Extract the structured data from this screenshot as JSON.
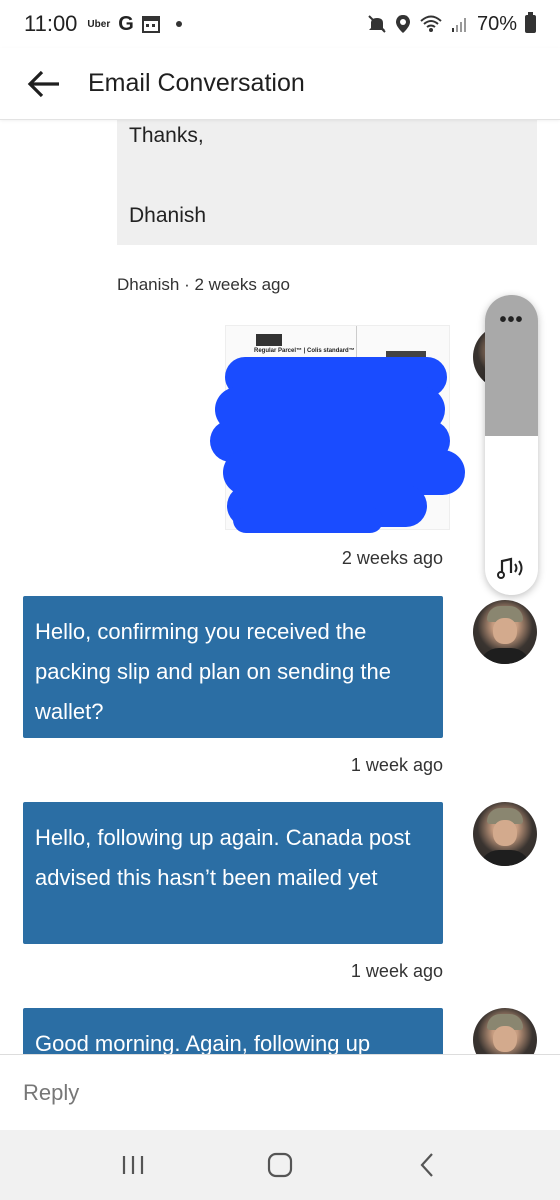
{
  "status_bar": {
    "time": "11:00",
    "uber_label": "Uber",
    "g_label": "G",
    "battery_pct": "70%",
    "icons": [
      "mute-icon",
      "location-icon",
      "wifi-icon",
      "signal-icon",
      "battery-icon"
    ]
  },
  "app_bar": {
    "title": "Email Conversation",
    "back_icon": "arrow-left-icon"
  },
  "conversation": {
    "previous_message": {
      "line1": "Thanks,",
      "line2": "Dhanish"
    },
    "attachment_meta": "Dhanish · 2 weeks ago",
    "attachment_doc_label": "Regular Parcel™ | Colis standard™",
    "attachment_time": "2 weeks ago",
    "messages": [
      {
        "text": "Hello, confirming you received the packing slip and plan on sending the wallet?",
        "time": "1 week ago"
      },
      {
        "text": "Hello, following up again. Canada post advised this hasn’t been mailed yet",
        "time": "1 week ago"
      },
      {
        "text": "Good morning. Again, following up",
        "time": ""
      }
    ],
    "bubble_color": "#2b6ea4"
  },
  "volume_panel": {
    "more_label": "•••",
    "level": 0.47,
    "sound_icon": "music-note-icon"
  },
  "reply": {
    "placeholder": "Reply"
  },
  "nav_bar": {
    "icons": [
      "recents-icon",
      "home-icon",
      "back-icon"
    ]
  }
}
